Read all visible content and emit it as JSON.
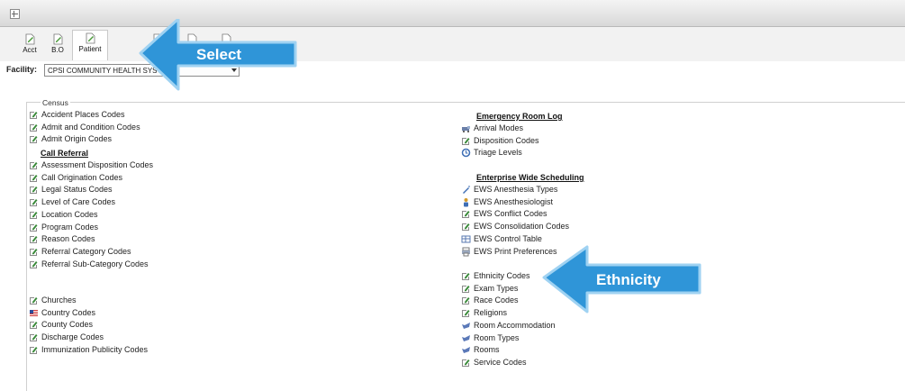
{
  "toolbar": {
    "buttons": [
      {
        "label": "Acct"
      },
      {
        "label": "B.O"
      },
      {
        "label": "Patient"
      }
    ]
  },
  "facility": {
    "label": "Facility:",
    "value": "CPSI COMMUNITY HEALTH SYSTEM"
  },
  "census": {
    "legend": "Census"
  },
  "left_column": {
    "top_items": [
      "Accident Places Codes",
      "Admit and Condition Codes",
      "Admit Origin Codes"
    ],
    "call_referral": {
      "title": "Call Referral",
      "items": [
        "Assessment Disposition Codes",
        "Call Origination Codes",
        "Legal Status Codes",
        "Level of Care Codes",
        "Location Codes",
        "Program Codes",
        "Reason Codes",
        "Referral Category Codes",
        "Referral Sub-Category Codes"
      ]
    },
    "bottom_items": [
      "Churches",
      "Country Codes",
      "County Codes",
      "Discharge Codes",
      "Immunization Publicity Codes"
    ]
  },
  "right_column": {
    "emergency_room_log": {
      "title": "Emergency Room Log",
      "items": [
        "Arrival Modes",
        "Disposition Codes",
        "Triage Levels"
      ]
    },
    "enterprise_wide_scheduling": {
      "title": "Enterprise Wide Scheduling",
      "items": [
        "EWS Anesthesia Types",
        "EWS Anesthesiologist",
        "EWS Conflict Codes",
        "EWS Consolidation Codes",
        "EWS Control Table",
        "EWS Print Preferences"
      ]
    },
    "bottom_items": [
      "Ethnicity Codes",
      "Exam Types",
      "Race Codes",
      "Religions",
      "Room Accommodation",
      "Room Types",
      "Rooms",
      "Service Codes"
    ]
  },
  "callouts": {
    "select": "Select",
    "ethnicity": "Ethnicity"
  },
  "colors": {
    "callout_blue": "#2f95d8",
    "callout_border": "#a9d8f5",
    "icon_green": "#3a8a3a"
  }
}
